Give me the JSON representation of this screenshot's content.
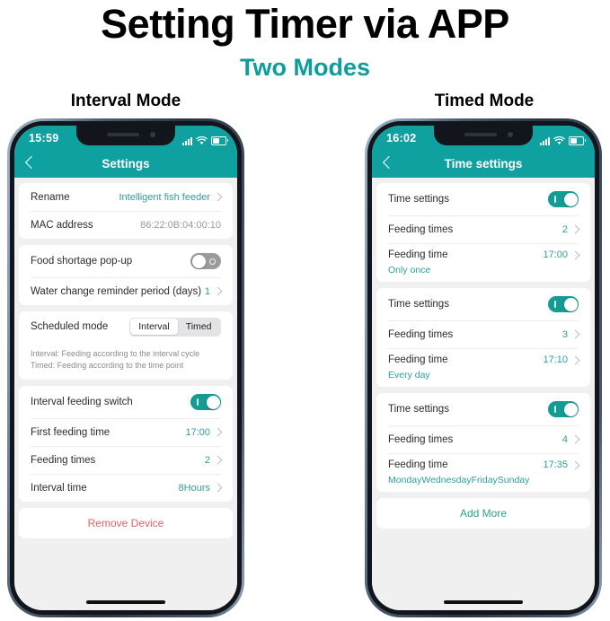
{
  "poster": {
    "title": "Setting Timer via APP",
    "subtitle": "Two Modes",
    "accent_color": "#0E9C9C",
    "left_mode_label": "Interval Mode",
    "right_mode_label": "Timed Mode"
  },
  "interval_phone": {
    "status": {
      "time": "15:59",
      "signal_icon": "signal-bars-icon",
      "wifi_icon": "wifi-icon",
      "battery_icon": "battery-icon"
    },
    "nav": {
      "title": "Settings",
      "back_icon": "back-chevron-icon"
    },
    "rows": {
      "rename_label": "Rename",
      "rename_value": "Intelligent fish feeder",
      "mac_label": "MAC address",
      "mac_value": "86:22:0B:04:00:10",
      "food_shortage_label": "Food shortage pop-up",
      "food_shortage_state": "off",
      "water_change_label": "Water change reminder period (days)",
      "water_change_value": "1",
      "scheduled_mode_label": "Scheduled mode",
      "seg_interval": "Interval",
      "seg_timed": "Timed",
      "seg_selected": "Interval",
      "description_line1": "Interval: Feeding according to the interval cycle",
      "description_line2": "Timed: Feeding according to the time point",
      "interval_switch_label": "Interval feeding switch",
      "interval_switch_state": "on",
      "first_feeding_label": "First feeding time",
      "first_feeding_value": "17:00",
      "feeding_times_label": "Feeding times",
      "feeding_times_value": "2",
      "interval_time_label": "Interval time",
      "interval_time_value": "8Hours",
      "remove_device_label": "Remove Device"
    }
  },
  "timed_phone": {
    "status": {
      "time": "16:02",
      "signal_icon": "signal-bars-icon",
      "wifi_icon": "wifi-icon",
      "battery_icon": "battery-icon"
    },
    "nav": {
      "title": "Time settings",
      "back_icon": "back-chevron-icon"
    },
    "groups": [
      {
        "time_settings_label": "Time settings",
        "time_settings_state": "on",
        "feeding_times_label": "Feeding times",
        "feeding_times_value": "2",
        "feeding_time_label": "Feeding time",
        "feeding_time_value": "17:00",
        "repeat": "Only once"
      },
      {
        "time_settings_label": "Time settings",
        "time_settings_state": "on",
        "feeding_times_label": "Feeding times",
        "feeding_times_value": "3",
        "feeding_time_label": "Feeding time",
        "feeding_time_value": "17:10",
        "repeat": "Every day"
      },
      {
        "time_settings_label": "Time settings",
        "time_settings_state": "on",
        "feeding_times_label": "Feeding times",
        "feeding_times_value": "4",
        "feeding_time_label": "Feeding time",
        "feeding_time_value": "17:35",
        "repeat": "MondayWednesdayFridaySunday"
      }
    ],
    "add_more_label": "Add More"
  }
}
